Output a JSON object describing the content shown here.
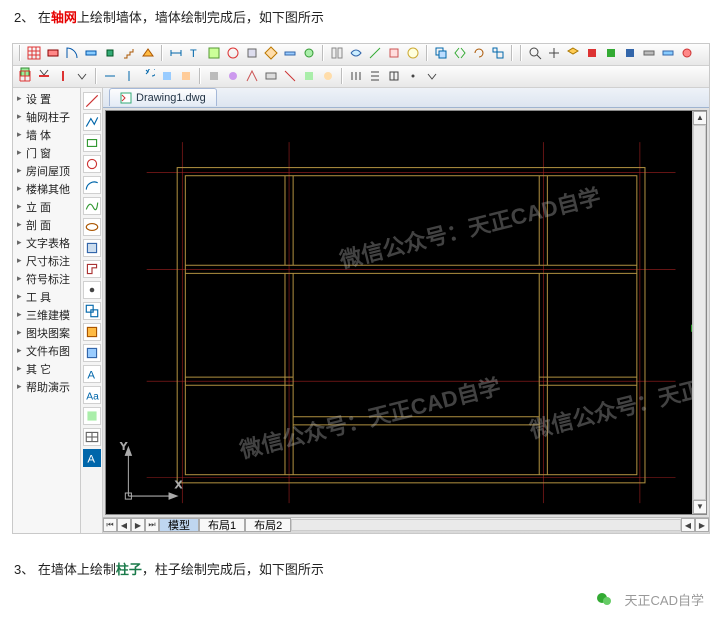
{
  "captions": {
    "top_num": "2、",
    "top_pre": "在",
    "top_hl": "轴网",
    "top_post": "上绘制墙体，墙体绘制完成后，如下图所示",
    "bottom_num": "3、",
    "bottom_pre": "在墙体上绘制",
    "bottom_hl": "柱子",
    "bottom_post": "，柱子绘制完成后，如下图所示"
  },
  "file_tab": "Drawing1.dwg",
  "left_tree": [
    "设  置",
    "轴网柱子",
    "墙  体",
    "门  窗",
    "房间屋顶",
    "楼梯其他",
    "立  面",
    "剖  面",
    "文字表格",
    "尺寸标注",
    "符号标注",
    "工  具",
    "三维建模",
    "图块图案",
    "文件布图",
    "其  它",
    "帮助演示"
  ],
  "layout_tabs": {
    "active": "模型",
    "b1": "布局1",
    "b2": "布局2"
  },
  "ucs": {
    "x": "X",
    "y": "Y"
  },
  "watermark": "微信公众号：天正CAD自学",
  "footer_label": "天正CAD自学"
}
